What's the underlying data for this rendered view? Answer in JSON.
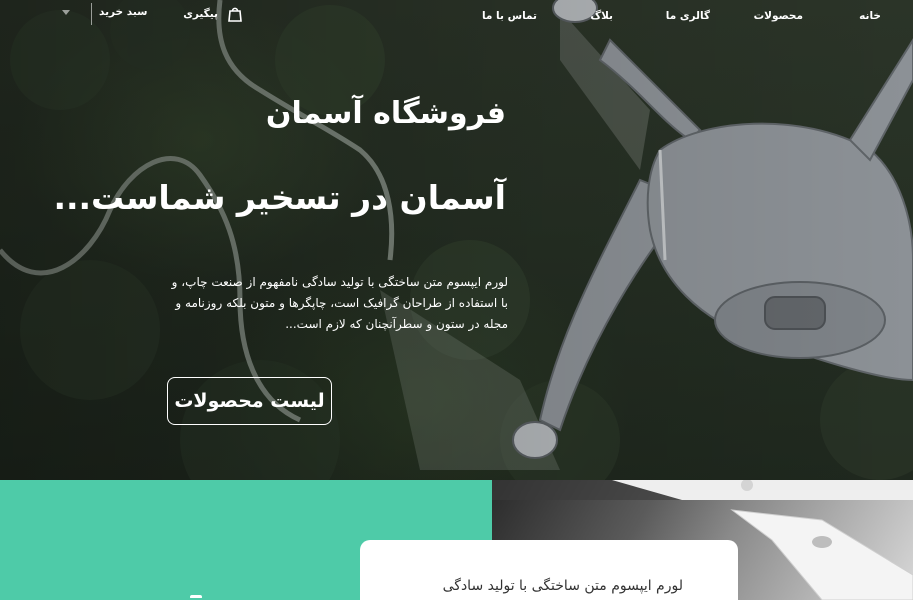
{
  "nav": {
    "home": "خانه",
    "products": "محصولات",
    "gallery": "گالری ما",
    "blog": "بلاگ",
    "contact": "تماس با ما",
    "tracking": "پیگیری",
    "cart": "سبد خرید",
    "tracking_icon": "shopping-bag-icon",
    "cart_icon": "chevron-down-icon"
  },
  "hero": {
    "title": "فروشگاه آسمان",
    "slogan": "آسمان در تسخیر شماست...",
    "description": "لورم ایپسوم متن ساختگی با تولید سادگی نامفهوم از صنعت چاپ، و با استفاده از طراحان گرافیک است، چاپگرها و متون بلکه روزنامه و مجله در ستون و سطرآنچنان که لازم است...",
    "button": "لیست محصولات",
    "image_icon": "drone-photo"
  },
  "lower": {
    "card_text": "لورم ایپسوم متن ساختگی با تولید سادگی",
    "teal_color": "#4ecba8"
  }
}
